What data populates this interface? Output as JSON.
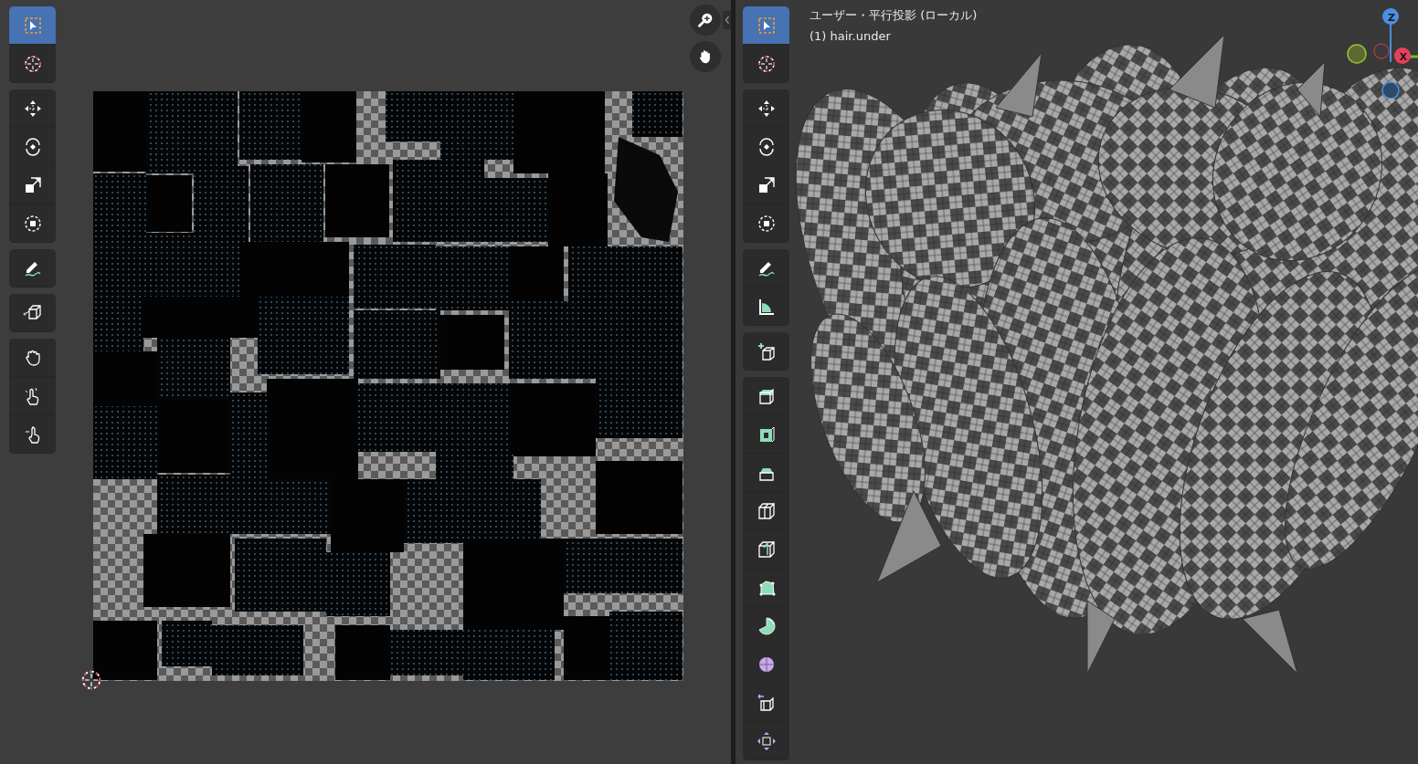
{
  "uv_editor": {
    "toolbar": [
      [
        {
          "kind": "select-box",
          "selected": true
        },
        {
          "kind": "cursor",
          "selected": false
        }
      ],
      [
        {
          "kind": "move",
          "selected": false
        },
        {
          "kind": "rotate",
          "selected": false
        },
        {
          "kind": "scale",
          "selected": false
        },
        {
          "kind": "transform",
          "selected": false
        }
      ],
      [
        {
          "kind": "annotate",
          "selected": false
        }
      ],
      [
        {
          "kind": "rip",
          "selected": false
        }
      ],
      [
        {
          "kind": "grab",
          "selected": false
        },
        {
          "kind": "relax",
          "selected": false
        },
        {
          "kind": "pinch",
          "selected": false
        }
      ]
    ],
    "nav": [
      {
        "kind": "zoom"
      },
      {
        "kind": "pan"
      }
    ]
  },
  "viewport": {
    "title": "ユーザー・平行投影 (ローカル)",
    "object": "(1) hair.under",
    "gizmo": [
      {
        "kind": "z",
        "label": "Z"
      },
      {
        "kind": "x",
        "label": "X"
      }
    ],
    "toolbar": [
      [
        {
          "kind": "select-box",
          "selected": true
        },
        {
          "kind": "cursor",
          "selected": false
        }
      ],
      [
        {
          "kind": "move",
          "selected": false
        },
        {
          "kind": "rotate",
          "selected": false
        },
        {
          "kind": "scale",
          "selected": false
        },
        {
          "kind": "transform",
          "selected": false
        }
      ],
      [
        {
          "kind": "annotate",
          "selected": false
        },
        {
          "kind": "measure",
          "selected": false
        }
      ],
      [
        {
          "kind": "add-cube",
          "selected": false
        }
      ],
      [
        {
          "kind": "extrude",
          "selected": false
        },
        {
          "kind": "inset",
          "selected": false
        },
        {
          "kind": "bevel",
          "selected": false
        },
        {
          "kind": "loopcut",
          "selected": false
        },
        {
          "kind": "knife",
          "selected": false
        },
        {
          "kind": "polybuild",
          "selected": false
        },
        {
          "kind": "spin",
          "selected": false
        },
        {
          "kind": "smooth",
          "selected": false
        },
        {
          "kind": "edge-slide",
          "selected": false
        },
        {
          "kind": "shrink",
          "selected": false
        }
      ]
    ]
  }
}
